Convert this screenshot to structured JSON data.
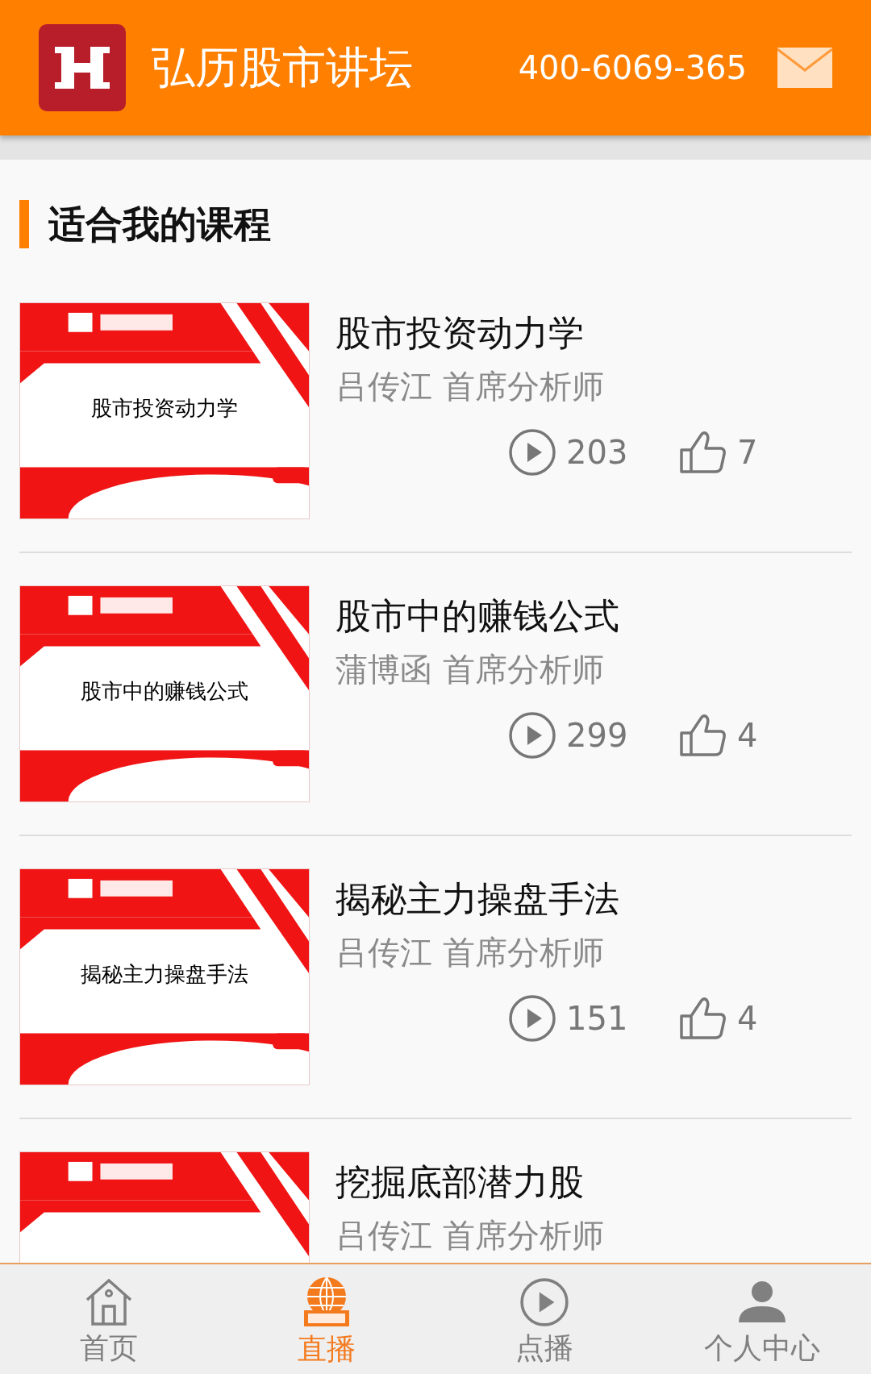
{
  "header": {
    "title": "弘历股市讲坛",
    "phone": "400-6069-365"
  },
  "section": {
    "title": "适合我的课程"
  },
  "courses": [
    {
      "title": "股市投资动力学",
      "teacher": "吕传江 首席分析师",
      "plays": "203",
      "likes": "7",
      "thumb_caption": "股市投资动力学"
    },
    {
      "title": "股市中的赚钱公式",
      "teacher": "蒲博函 首席分析师",
      "plays": "299",
      "likes": "4",
      "thumb_caption": "股市中的赚钱公式"
    },
    {
      "title": "揭秘主力操盘手法",
      "teacher": "吕传江 首席分析师",
      "plays": "151",
      "likes": "4",
      "thumb_caption": "揭秘主力操盘手法"
    },
    {
      "title": "挖掘底部潜力股",
      "teacher": "吕传江 首席分析师"
    }
  ],
  "nav": [
    {
      "kind": "home",
      "label": "首页",
      "selected": false
    },
    {
      "kind": "live",
      "label": "直播",
      "selected": true
    },
    {
      "kind": "play",
      "label": "点播",
      "selected": false
    },
    {
      "kind": "user",
      "label": "个人中心",
      "selected": false
    }
  ]
}
